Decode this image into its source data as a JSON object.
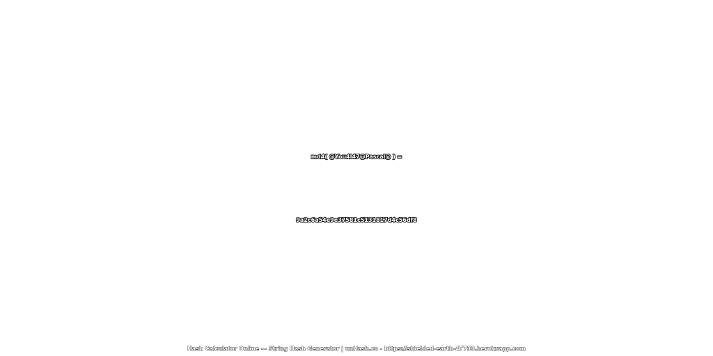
{
  "expression": "md4( @You4I47@Pascal@ ) =",
  "hash_value": "9a2c6a54e9e37581c5131817d4c56df8",
  "footer": {
    "site_title": "Hash Calculator Online — String Hash Generator | unHash.co - ",
    "site_url": "https://shielded-earth-47733.herokuapp.com"
  }
}
